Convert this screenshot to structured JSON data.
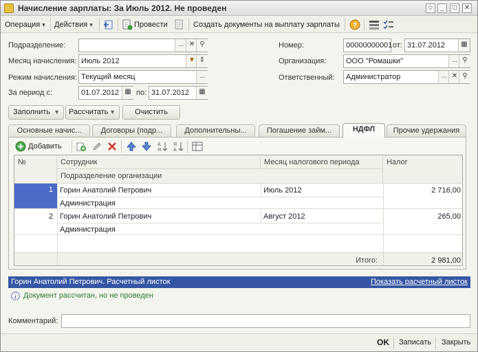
{
  "window": {
    "title": "Начисление зарплаты: За Июль 2012. Не проведен"
  },
  "toolbar": {
    "operation": "Операция",
    "actions": "Действия",
    "post": "Провести",
    "create_docs": "Создать документы на выплату зарплаты"
  },
  "form": {
    "department_label": "Подразделение:",
    "department_value": "",
    "month_label": "Месяц начисления:",
    "month_value": "Июль 2012",
    "mode_label": "Режим начисления:",
    "mode_value": "Текущий месяц",
    "period_from_label": "За период с:",
    "period_from_value": "01.07.2012",
    "period_to_label": "по:",
    "period_to_value": "31.07.2012",
    "number_label": "Номер:",
    "number_value": "00000000001",
    "date_from_label": "от:",
    "date_value": "31.07.2012",
    "org_label": "Организация:",
    "org_value": "ООО \"Ромашки\"",
    "resp_label": "Ответственный:",
    "resp_value": "Администратор"
  },
  "buttons": {
    "fill": "Заполнить",
    "calculate": "Рассчитать",
    "clear": "Очистить"
  },
  "tabs": [
    {
      "label": "Основные начис..."
    },
    {
      "label": "Договоры (подр..."
    },
    {
      "label": "Дополнительны..."
    },
    {
      "label": "Погашение займ..."
    },
    {
      "label": "НДФЛ"
    },
    {
      "label": "Прочие удержания"
    }
  ],
  "grid_toolbar": {
    "add": "Добавить"
  },
  "table": {
    "headers": {
      "num": "№",
      "employee": "Сотрудник",
      "department": "Подразделение организации",
      "period": "Месяц налогового периода",
      "tax": "Налог"
    },
    "rows": [
      {
        "num": "1",
        "employee": "Горин Анатолий Петрович",
        "department": "Администрация",
        "period": "Июль 2012",
        "tax": "2 716,00"
      },
      {
        "num": "2",
        "employee": "Горин Анатолий Петрович",
        "department": "Администрация",
        "period": "Август 2012",
        "tax": "265,00"
      }
    ],
    "total_label": "Итого:",
    "total_value": "2 981,00"
  },
  "status": {
    "payslip_title": "Горин Анатолий Петрович. Расчетный листок",
    "show_payslip": "Показать расчетный листок",
    "info_message": "Документ рассчитан, но не проведен"
  },
  "comment": {
    "label": "Комментарий:",
    "value": ""
  },
  "footer": {
    "ok": "OK",
    "save": "Записать",
    "close": "Закрыть"
  },
  "colors": {
    "accent": "#3556a4",
    "selected_cell": "#4a6bc8",
    "info_text": "#2e7d32"
  }
}
